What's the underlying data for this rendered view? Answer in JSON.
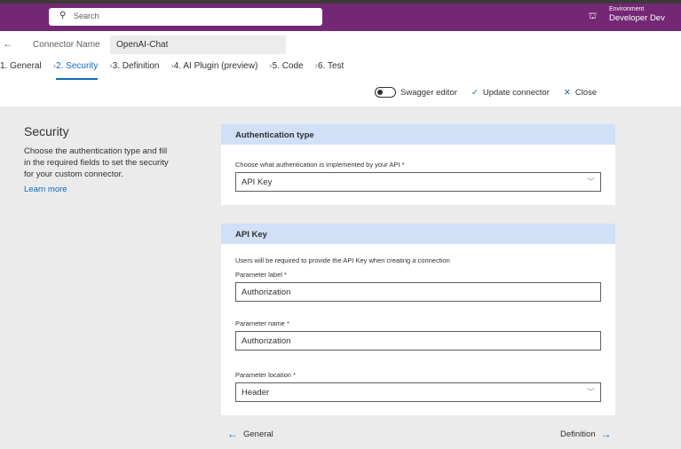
{
  "topbar": {
    "search_placeholder": "Search",
    "environment_label": "Environment",
    "environment_value": "Developer Dev"
  },
  "header": {
    "connector_name_label": "Connector Name",
    "connector_name_value": "OpenAI-Chat"
  },
  "steps": [
    {
      "label": "1. General"
    },
    {
      "label": "2. Security",
      "active": true
    },
    {
      "label": "3. Definition"
    },
    {
      "label": "4. AI Plugin (preview)"
    },
    {
      "label": "5. Code"
    },
    {
      "label": "6. Test"
    }
  ],
  "actions": {
    "swagger": "Swagger editor",
    "swagger_on": false,
    "update": "Update connector",
    "close": "Close"
  },
  "left": {
    "title": "Security",
    "description": "Choose the authentication type and fill in the required fields to set the security for your custom connector.",
    "link": "Learn more"
  },
  "auth": {
    "title": "Authentication type",
    "label": "Choose what authentication is implemented by your API *",
    "value": "API Key"
  },
  "apikey": {
    "title": "API Key",
    "note": "Users will be required to provide the API Key when creating a connection",
    "param_label_label": "Parameter label *",
    "param_label_value": "Authorization",
    "param_name_label": "Parameter name *",
    "param_name_value": "Authorization",
    "param_location_label": "Parameter location *",
    "param_location_value": "Header"
  },
  "nav": {
    "prev": "General",
    "next": "Definition"
  },
  "colors": {
    "brand": "#742774",
    "accent": "#0f6cbd",
    "section_header": "#cfe0f7"
  }
}
